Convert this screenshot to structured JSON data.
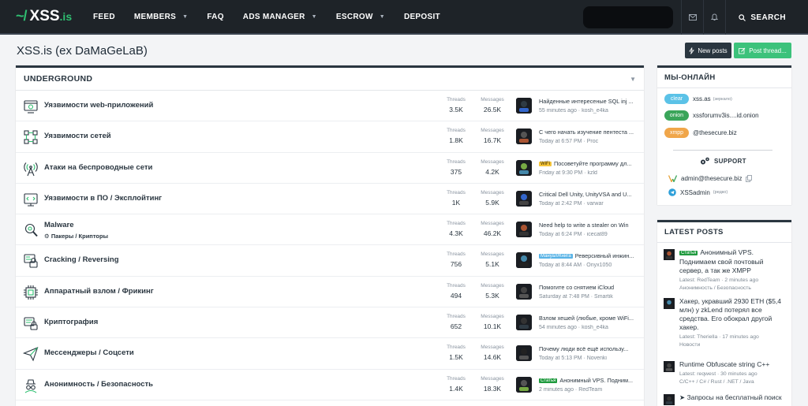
{
  "logo": {
    "prefix": "~/",
    "name": "XSS",
    "tld": ".is"
  },
  "nav": [
    {
      "label": "FEED",
      "dropdown": false
    },
    {
      "label": "MEMBERS",
      "dropdown": true
    },
    {
      "label": "FAQ",
      "dropdown": false
    },
    {
      "label": "ADS MANAGER",
      "dropdown": true
    },
    {
      "label": "ESCROW",
      "dropdown": true
    },
    {
      "label": "DEPOSIT",
      "dropdown": false
    }
  ],
  "search_label": "SEARCH",
  "page_title": "XSS.is (ex DaMaGeLaB)",
  "buttons": {
    "new_posts": "New posts",
    "post_thread": "Post thread..."
  },
  "forum": {
    "category": "UNDERGROUND",
    "labels": {
      "threads": "Threads",
      "messages": "Messages"
    },
    "rows": [
      {
        "name": "Уязвимости web-приложений",
        "icon": "web-vuln-icon",
        "threads": "3.5K",
        "messages": "26.5K",
        "prefix": "",
        "last_title": "Найденные интересеные SQL inj ...",
        "last_meta": "55 minutes ago · kosh_e4ka"
      },
      {
        "name": "Уязвимости сетей",
        "icon": "network-icon",
        "threads": "1.8K",
        "messages": "16.7K",
        "prefix": "",
        "last_title": "С чего начать изучение пентеста ...",
        "last_meta": "Today at 6:57 PM · Proc"
      },
      {
        "name": "Атаки на беспроводные сети",
        "icon": "wireless-icon",
        "threads": "375",
        "messages": "4.2K",
        "prefix": "WiFi",
        "last_title": "Посоветуйте программу дл...",
        "last_meta": "Friday at 9:30 PM · kzld"
      },
      {
        "name": "Уязвимости в ПО / Эксплойтинг",
        "icon": "software-icon",
        "threads": "1K",
        "messages": "5.9K",
        "prefix": "",
        "last_title": "Critical Dell Unity, UnityVSA and U...",
        "last_meta": "Today at 2:42 PM · varwar"
      },
      {
        "name": "Malware",
        "subforum": "Пакеры / Крипторы",
        "icon": "malware-icon",
        "threads": "4.3K",
        "messages": "46.2K",
        "prefix": "",
        "last_title": "Need help to write a stealer on Win",
        "last_meta": "Today at 6:24 PM · icecat89"
      },
      {
        "name": "Cracking / Reversing",
        "icon": "cracking-icon",
        "threads": "756",
        "messages": "5.1K",
        "prefix": "Мануал/Книга",
        "last_title": "Реверсивный инжин...",
        "last_meta": "Today at 8:44 AM · Onyx1050"
      },
      {
        "name": "Аппаратный взлом / Фрикинг",
        "icon": "chip-icon",
        "threads": "494",
        "messages": "5.3K",
        "prefix": "",
        "last_title": "Помогите со снятием iCloud",
        "last_meta": "Saturday at 7:48 PM · Smartik"
      },
      {
        "name": "Криптография",
        "icon": "crypto-icon",
        "threads": "652",
        "messages": "10.1K",
        "prefix": "",
        "last_title": "Взлом хешей (любые, кроме WiFi...",
        "last_meta": "54 minutes ago · kosh_e4ka"
      },
      {
        "name": "Мессенджеры / Соцсети",
        "icon": "paper-plane-icon",
        "threads": "1.5K",
        "messages": "14.6K",
        "prefix": "",
        "last_title": "Почему люди всё ещё использу...",
        "last_meta": "Today at 5:13 PM · Novenki"
      },
      {
        "name": "Анонимность / Безопасность",
        "icon": "anonymity-icon",
        "threads": "1.4K",
        "messages": "18.3K",
        "prefix": "Статья",
        "last_title": "Анонимный VPS. Подним...",
        "last_meta": "2 minutes ago · RedTeam"
      }
    ]
  },
  "online": {
    "title": "МЫ-ОНЛАЙН",
    "mirrors": [
      {
        "tag": "clear",
        "addr": "xss.as",
        "note": "(зеркало)"
      },
      {
        "tag": "onion",
        "addr": "xssforumv3is....id.onion",
        "note": ""
      },
      {
        "tag": "xmpp",
        "addr": "@thesecure.biz",
        "note": ""
      }
    ],
    "support_title": "SUPPORT",
    "email": "admin@thesecure.biz",
    "telegram": "XSSadmin",
    "telegram_note": "(редко)"
  },
  "latest": {
    "title": "LATEST POSTS",
    "posts": [
      {
        "prefix": "Статья",
        "title": "Анонимный VPS. Поднимаем свой почтовый сервер, а так же XMPP",
        "meta": "Latest: RedTeam · 2 minutes ago",
        "forum": "Анонимность / Безопасность"
      },
      {
        "prefix": "",
        "title": "Хакер, укравший 2930 ETH ($5,4 млн) у zkLend потерял все средства. Его обокрал другой хакер.",
        "meta": "Latest: Theriella · 17 minutes ago",
        "forum": "Новости"
      },
      {
        "prefix": "",
        "title": "Runtime Obfuscate string C++",
        "meta": "Latest: reqwest · 30 minutes ago",
        "forum": "C/C++ / C# / Rust / .NET / Java"
      },
      {
        "prefix": "",
        "title": "➤ Запросы на бесплатный поиск",
        "meta": "",
        "forum": ""
      }
    ]
  },
  "colors": {
    "accent_green": "#2fbf71",
    "dark": "#1e2328",
    "new_post_btn": "#2a3640",
    "post_thread_btn": "#3cc27b"
  }
}
